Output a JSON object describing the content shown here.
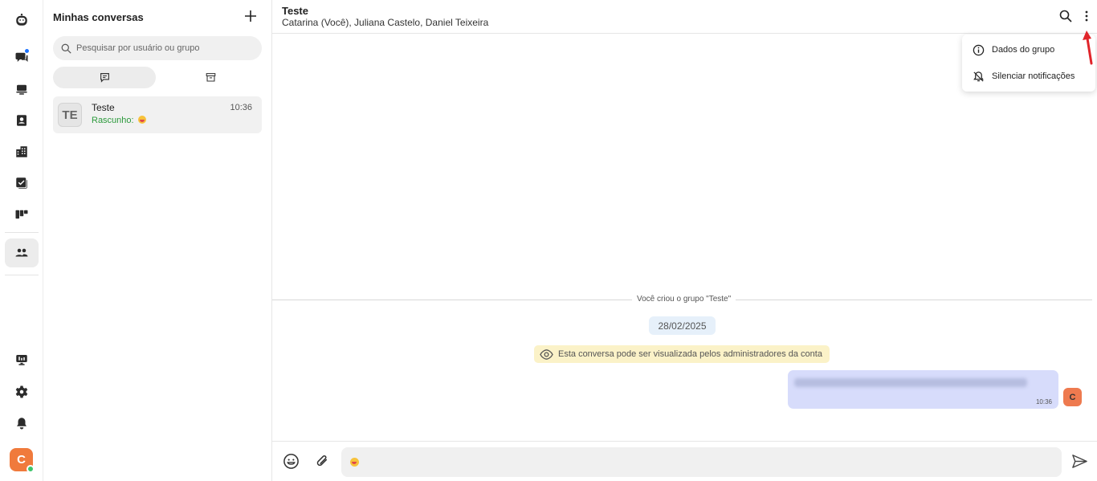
{
  "colors": {
    "accent_blue": "#1e74ff",
    "online": "#3cc46a",
    "avatar_orange": "#f07a3c",
    "draft_green": "#2c9a3c",
    "bubble": "#d7dcfb",
    "notice": "#fbf2c8",
    "annotation_arrow": "#e0252b"
  },
  "rail": {
    "items": [
      {
        "icon": "chats-icon",
        "badge": true
      },
      {
        "icon": "inbox-icon"
      },
      {
        "icon": "contacts-icon"
      },
      {
        "icon": "company-icon"
      },
      {
        "icon": "tasks-icon"
      },
      {
        "icon": "kanban-icon"
      },
      {
        "icon": "team-chat-icon",
        "active": true
      }
    ],
    "bottom": [
      "monitor-icon",
      "settings-gear-icon",
      "notifications-bell-icon"
    ],
    "user_initial": "C"
  },
  "conversations": {
    "title": "Minhas conversas",
    "search_placeholder": "Pesquisar por usuário ou grupo",
    "tabs": [
      "chat-tab-icon",
      "archive-tab-icon"
    ],
    "items": [
      {
        "initials": "TE",
        "name": "Teste",
        "time": "10:36",
        "draft_label": "Rascunho:"
      }
    ]
  },
  "chat": {
    "title": "Teste",
    "members": "Catarina (Você), Juliana Castelo, Daniel Teixeira",
    "menu": [
      "Dados do grupo",
      "Silenciar notificações"
    ],
    "system_message": "Você criou o grupo \"Teste\"",
    "date": "28/02/2025",
    "notice": "Esta conversa pode ser visualizada pelos administradores da conta",
    "message": {
      "time": "10:36",
      "avatar_initial": "C"
    }
  }
}
